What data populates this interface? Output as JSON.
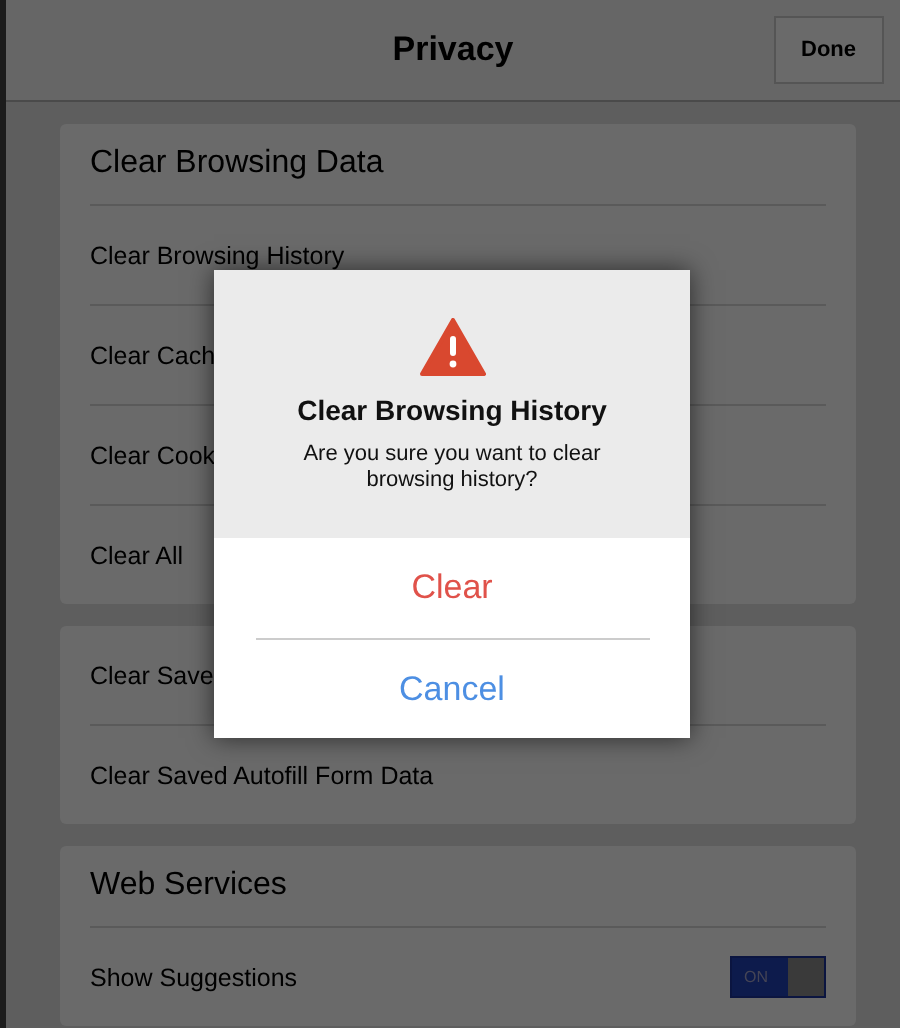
{
  "nav_bar": {
    "title": "Privacy",
    "done_button": "Done"
  },
  "sections": [
    {
      "header": "Clear Browsing Data",
      "rows": [
        {
          "kind": "action",
          "label": "Clear Browsing History"
        },
        {
          "kind": "action",
          "label": "Clear Cach"
        },
        {
          "kind": "action",
          "label": "Clear Cook"
        },
        {
          "kind": "action",
          "label": "Clear All"
        }
      ]
    },
    {
      "rows": [
        {
          "kind": "action",
          "label": "Clear Save"
        },
        {
          "kind": "action",
          "label": "Clear Saved Autofill Form Data"
        }
      ]
    },
    {
      "header": "Web Services",
      "rows": [
        {
          "kind": "toggle",
          "label": "Show Suggestions",
          "on": true,
          "toggle_label": "ON"
        }
      ]
    }
  ],
  "alert": {
    "title": "Clear Browsing History",
    "message": "Are you sure you want to clear browsing history?",
    "buttons": [
      {
        "kind": "destructive",
        "label": "Clear"
      },
      {
        "kind": "cancel",
        "label": "Cancel"
      }
    ]
  }
}
